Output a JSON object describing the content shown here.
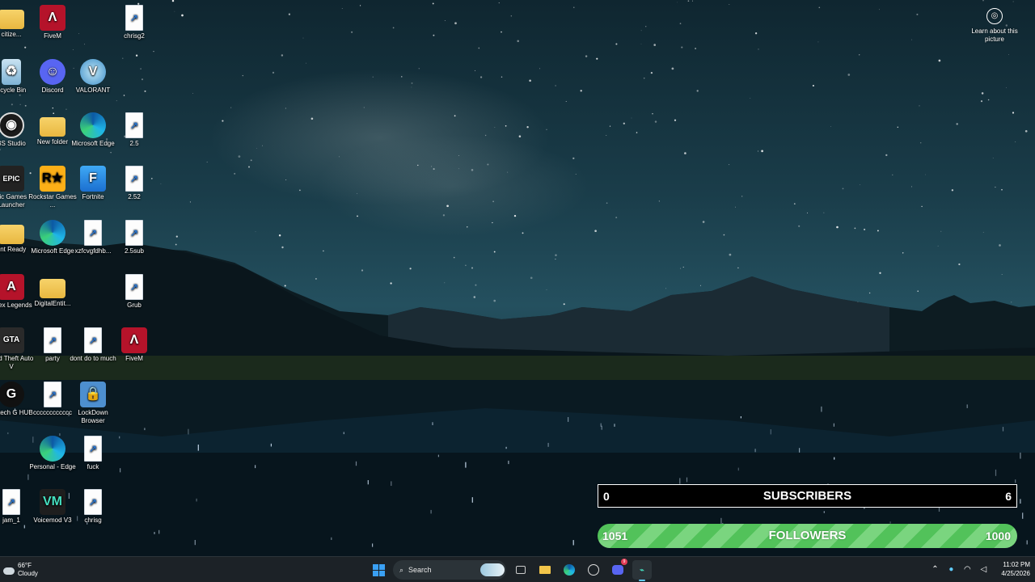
{
  "desktop": {
    "icons": [
      {
        "label": "citize...",
        "icon": "folder-icon"
      },
      {
        "label": "FiveM",
        "icon": "fivem-icon"
      },
      {
        "label": "chrisg2",
        "icon": "shortcut-file-icon"
      },
      {
        "label": "ecycle Bin",
        "icon": "recycle-bin-icon"
      },
      {
        "label": "Discord",
        "icon": "discord-icon"
      },
      {
        "label": "VALORANT",
        "icon": "valorant-icon"
      },
      {
        "label": "BS Studio",
        "icon": "obs-icon"
      },
      {
        "label": "New folder",
        "icon": "folder-icon"
      },
      {
        "label": "Microsoft Edge",
        "icon": "edge-icon"
      },
      {
        "label": "2.5",
        "icon": "shortcut-file-icon"
      },
      {
        "label": "pic Games Launcher",
        "icon": "epic-games-icon"
      },
      {
        "label": "Rockstar Games ...",
        "icon": "rockstar-icon"
      },
      {
        "label": "Fortnite",
        "icon": "fortnite-icon"
      },
      {
        "label": "2.52",
        "icon": "shortcut-file-icon"
      },
      {
        "label": "rint Ready",
        "icon": "folder-icon"
      },
      {
        "label": "Microsoft Edge",
        "icon": "edge-icon"
      },
      {
        "label": "xzfcvgfdhb...",
        "icon": "shortcut-file-icon"
      },
      {
        "label": "2.5sub",
        "icon": "shortcut-file-icon"
      },
      {
        "label": "Apex Legends",
        "icon": "apex-icon"
      },
      {
        "label": "DigitalEntit...",
        "icon": "folder-icon"
      },
      {
        "label": "Grub",
        "icon": "shortcut-file-icon"
      },
      {
        "label": "rand Theft Auto V",
        "icon": "gta-icon"
      },
      {
        "label": "party",
        "icon": "shortcut-file-icon"
      },
      {
        "label": "dont do to much",
        "icon": "shortcut-file-icon"
      },
      {
        "label": "FiveM",
        "icon": "fivem-icon"
      },
      {
        "label": "ogitech G HUB",
        "icon": "logitech-icon"
      },
      {
        "label": "cccccccccccc",
        "icon": "shortcut-file-icon"
      },
      {
        "label": "LockDown Browser",
        "icon": "lockdown-icon"
      },
      {
        "label": "Personal - Edge",
        "icon": "edge-icon"
      },
      {
        "label": "fuck",
        "icon": "shortcut-file-icon"
      },
      {
        "label": "jam_1",
        "icon": "shortcut-file-icon"
      },
      {
        "label": "Voicemod V3",
        "icon": "voicemod-icon"
      },
      {
        "label": "chrisg",
        "icon": "shortcut-file-icon"
      }
    ],
    "learn_about_picture": "Learn about this picture"
  },
  "overlay": {
    "subscribers": {
      "left": "0",
      "label": "SUBSCRIBERS",
      "right": "6"
    },
    "followers": {
      "left": "1051",
      "label": "FOLLOWERS",
      "right": "1000"
    }
  },
  "taskbar": {
    "weather_temp": "66°F",
    "weather_desc": "Cloudy",
    "search_label": "Search",
    "time": "11:02 PM",
    "date": "4/25/2026",
    "discord_badge": "9"
  },
  "colors": {
    "followers_bar": "#52c25a",
    "taskbar_bg": "#1c2227",
    "accent": "#60cdff"
  }
}
